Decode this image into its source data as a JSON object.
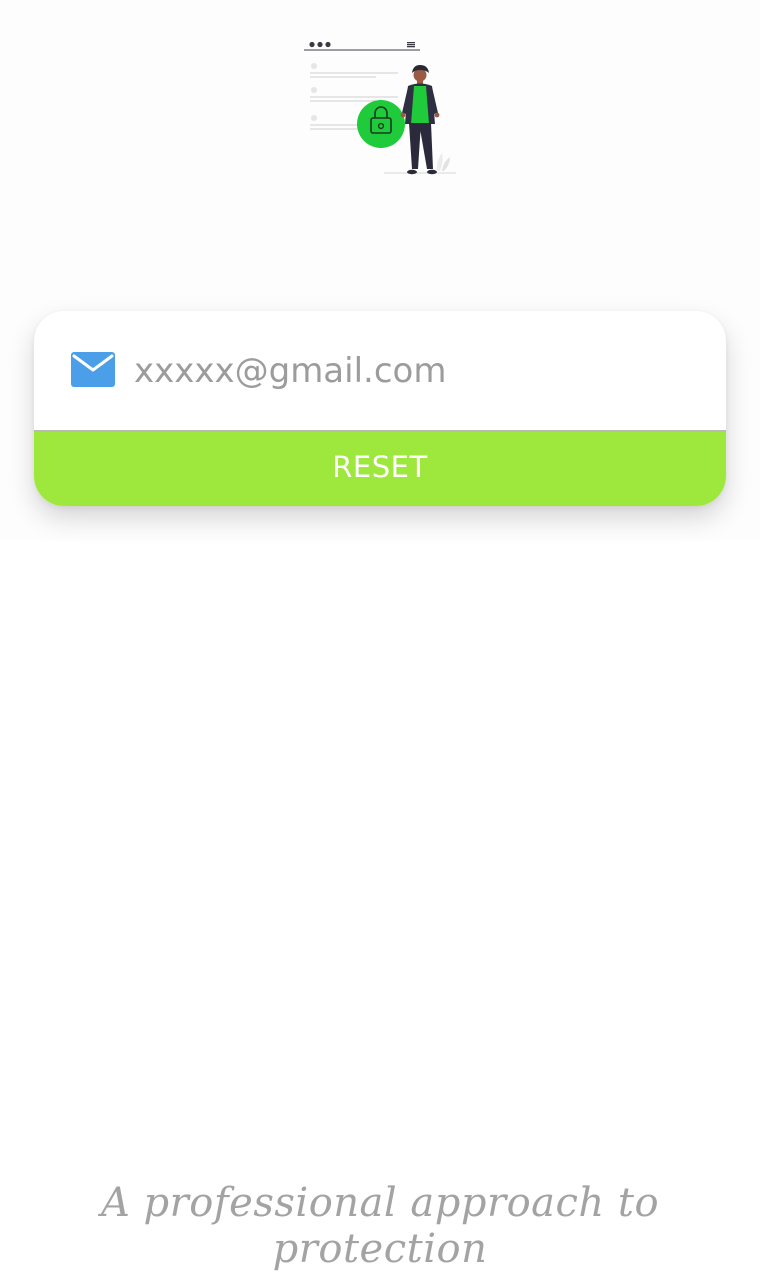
{
  "email_form": {
    "email_placeholder": "xxxxx@gmail.com",
    "email_value": "",
    "reset_label": "RESET"
  },
  "tagline": "A professional approach to protection",
  "icons": {
    "email": "mail-icon",
    "illustration": "security-lock-illustration"
  },
  "colors": {
    "reset_button": "#9ee73c",
    "mail_icon": "#4a9fe8",
    "lock_circle": "#1fcb3a",
    "placeholder_text": "#9c9c9c",
    "tagline_text": "#a3a3a3"
  }
}
